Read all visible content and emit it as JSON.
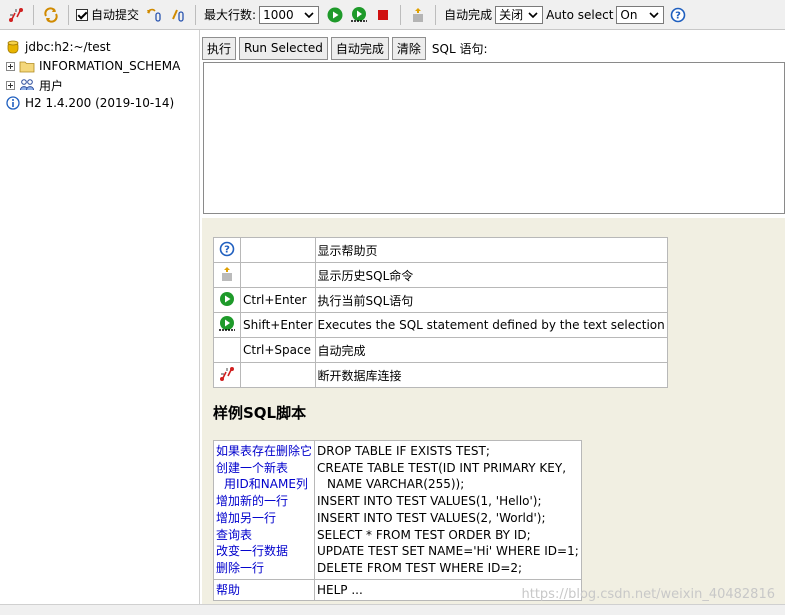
{
  "toolbar": {
    "auto_commit_label": "自动提交",
    "max_rows_label": "最大行数:",
    "max_rows_value": "1000",
    "auto_complete_label": "自动完成",
    "auto_complete_value": "关闭",
    "auto_select_label": "Auto select",
    "auto_select_value": "On"
  },
  "tree": {
    "connection": "jdbc:h2:~/test",
    "items": [
      "INFORMATION_SCHEMA",
      "用户"
    ],
    "version": "H2 1.4.200 (2019-10-14)"
  },
  "query": {
    "execute_label": "执行",
    "run_selected_label": "Run Selected",
    "auto_complete_label": "自动完成",
    "clear_label": "清除",
    "sql_label": "SQL 语句:",
    "sql_text": ""
  },
  "help": {
    "rows": [
      {
        "icon": "help-icon",
        "key": "",
        "desc": "显示帮助页"
      },
      {
        "icon": "history-icon",
        "key": "",
        "desc": "显示历史SQL命令"
      },
      {
        "icon": "run-icon",
        "key": "Ctrl+Enter",
        "desc": "执行当前SQL语句"
      },
      {
        "icon": "run-selected-icon",
        "key": "Shift+Enter",
        "desc": "Executes the SQL statement defined by the text selection"
      },
      {
        "icon": "",
        "key": "Ctrl+Space",
        "desc": "自动完成"
      },
      {
        "icon": "disconnect-icon",
        "key": "",
        "desc": "断开数据库连接"
      }
    ]
  },
  "samples": {
    "title": "样例SQL脚本",
    "labels": [
      "如果表存在删除它",
      "创建一个新表",
      "用ID和NAME列",
      "增加新的一行",
      "增加另一行",
      "查询表",
      "改变一行数据",
      "删除一行"
    ],
    "sql": [
      "DROP TABLE IF EXISTS TEST;",
      "CREATE TABLE TEST(ID INT PRIMARY KEY,",
      "NAME VARCHAR(255));",
      "INSERT INTO TEST VALUES(1, 'Hello');",
      "INSERT INTO TEST VALUES(2, 'World');",
      "SELECT * FROM TEST ORDER BY ID;",
      "UPDATE TEST SET NAME='Hi' WHERE ID=1;",
      "DELETE FROM TEST WHERE ID=2;"
    ],
    "help_label": "帮助",
    "help_sql": "HELP ..."
  },
  "watermark": "https://blog.csdn.net/weixin_40482816",
  "colors": {
    "run_green": "#1e9a2a",
    "stop_red": "#d01010",
    "link_blue": "#0000cc",
    "panel_bg": "#f1efe2"
  }
}
